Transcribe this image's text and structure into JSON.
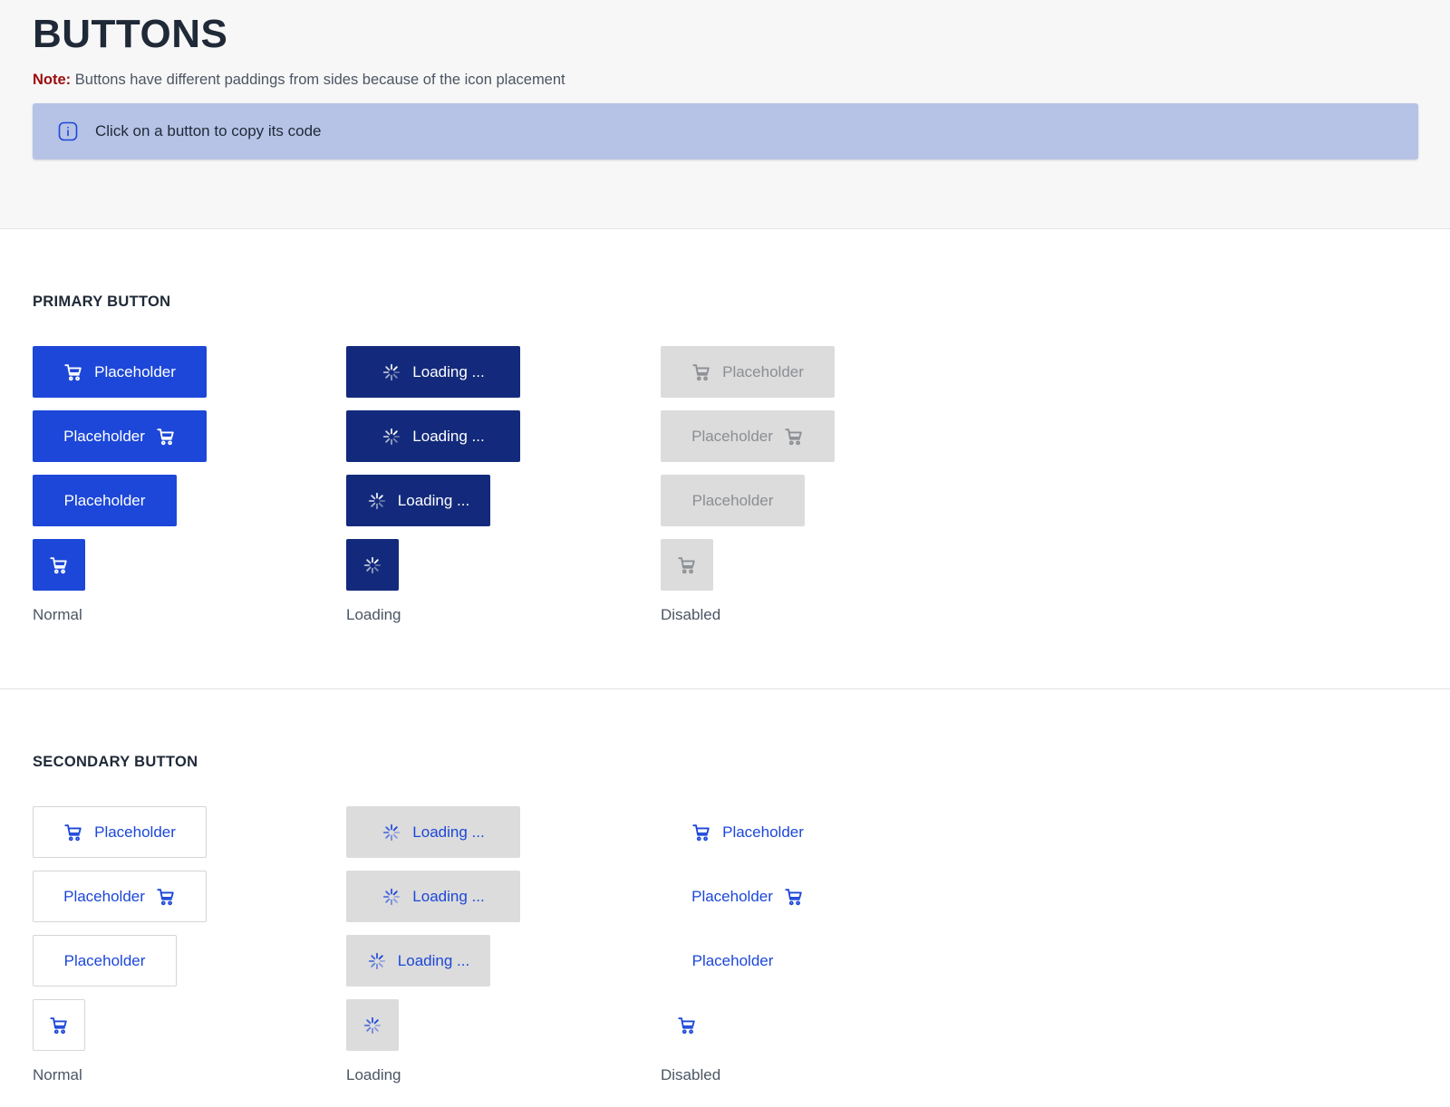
{
  "page": {
    "title": "BUTTONS",
    "note_label": "Note:",
    "note_text": " Buttons have different paddings from sides because of the icon placement",
    "info_text": "Click on a button to copy its code"
  },
  "primary": {
    "title": "PRIMARY BUTTON",
    "labels": {
      "normal": "Normal",
      "loading": "Loading",
      "disabled": "Disabled"
    },
    "normal_text": "Placeholder",
    "loading_text": "Loading ...",
    "disabled_text": "Placeholder"
  },
  "secondary": {
    "title": "SECONDARY BUTTON",
    "labels": {
      "normal": "Normal",
      "loading": "Loading",
      "disabled": "Disabled"
    },
    "normal_text": "Placeholder",
    "loading_text": "Loading ...",
    "disabled_text": "Placeholder"
  },
  "icons": {
    "info": "info-icon",
    "cart": "cart-icon",
    "spinner": "spinner-icon"
  },
  "colors": {
    "primary": "#1c47d8",
    "primary_loading": "#132a7c",
    "disabled_bg": "#dcdcdc",
    "disabled_text": "#8b8e94",
    "info_bg": "#b6c3e6",
    "note_label": "#9b0d0d"
  }
}
